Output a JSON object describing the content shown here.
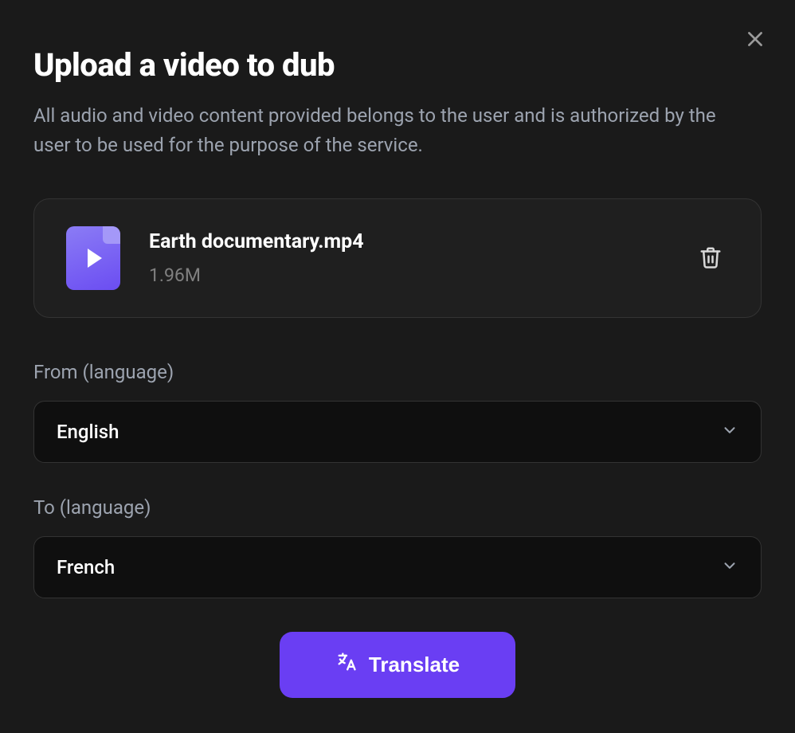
{
  "header": {
    "title": "Upload a video to dub",
    "subtitle": "All audio and video content provided belongs to the user and is authorized by the user to be used for the purpose of the service."
  },
  "upload": {
    "file_name": "Earth documentary.mp4",
    "file_size": "1.96M"
  },
  "from": {
    "label": "From (language)",
    "value": "English"
  },
  "to": {
    "label": "To (language)",
    "value": "French"
  },
  "actions": {
    "translate_label": "Translate"
  }
}
